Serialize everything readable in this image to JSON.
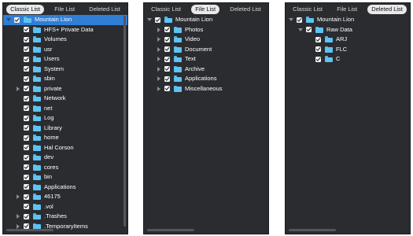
{
  "panels": [
    {
      "tabs": [
        {
          "label": "Classic List",
          "active": true
        },
        {
          "label": "File List",
          "active": false
        },
        {
          "label": "Deleted List",
          "active": false
        }
      ],
      "rows": [
        {
          "label": "Mountain Lion",
          "level": 0,
          "expander": "down",
          "selected": true
        },
        {
          "label": "HFS+ Private Data",
          "level": 1,
          "expander": "none",
          "selected": false
        },
        {
          "label": "Volumes",
          "level": 1,
          "expander": "none",
          "selected": false
        },
        {
          "label": "usr",
          "level": 1,
          "expander": "none",
          "selected": false
        },
        {
          "label": "Users",
          "level": 1,
          "expander": "none",
          "selected": false
        },
        {
          "label": "System",
          "level": 1,
          "expander": "none",
          "selected": false
        },
        {
          "label": "sbin",
          "level": 1,
          "expander": "none",
          "selected": false
        },
        {
          "label": "private",
          "level": 1,
          "expander": "right",
          "selected": false
        },
        {
          "label": "Network",
          "level": 1,
          "expander": "none",
          "selected": false
        },
        {
          "label": "net",
          "level": 1,
          "expander": "none",
          "selected": false
        },
        {
          "label": "Log",
          "level": 1,
          "expander": "none",
          "selected": false
        },
        {
          "label": "Library",
          "level": 1,
          "expander": "none",
          "selected": false
        },
        {
          "label": "home",
          "level": 1,
          "expander": "none",
          "selected": false
        },
        {
          "label": "Hal Corson",
          "level": 1,
          "expander": "none",
          "selected": false
        },
        {
          "label": "dev",
          "level": 1,
          "expander": "none",
          "selected": false
        },
        {
          "label": "cores",
          "level": 1,
          "expander": "none",
          "selected": false
        },
        {
          "label": "bin",
          "level": 1,
          "expander": "none",
          "selected": false
        },
        {
          "label": "Applications",
          "level": 1,
          "expander": "none",
          "selected": false
        },
        {
          "label": "46175",
          "level": 1,
          "expander": "right",
          "selected": false
        },
        {
          "label": ".vol",
          "level": 1,
          "expander": "none",
          "selected": false
        },
        {
          "label": ".Trashes",
          "level": 1,
          "expander": "right",
          "selected": false
        },
        {
          "label": ".TemporaryItems",
          "level": 1,
          "expander": "right",
          "selected": false
        }
      ]
    },
    {
      "tabs": [
        {
          "label": "Classic List",
          "active": false
        },
        {
          "label": "File List",
          "active": true
        },
        {
          "label": "Deleted List",
          "active": false
        }
      ],
      "rows": [
        {
          "label": "Mountain Lion",
          "level": 0,
          "expander": "down",
          "selected": false
        },
        {
          "label": "Photos",
          "level": 1,
          "expander": "right",
          "selected": false
        },
        {
          "label": "Video",
          "level": 1,
          "expander": "right",
          "selected": false
        },
        {
          "label": "Document",
          "level": 1,
          "expander": "right",
          "selected": false
        },
        {
          "label": "Text",
          "level": 1,
          "expander": "right",
          "selected": false
        },
        {
          "label": "Archive",
          "level": 1,
          "expander": "right",
          "selected": false
        },
        {
          "label": "Applications",
          "level": 1,
          "expander": "right",
          "selected": false
        },
        {
          "label": "Miscellaneous",
          "level": 1,
          "expander": "right",
          "selected": false
        }
      ]
    },
    {
      "tabs": [
        {
          "label": "Classic List",
          "active": false
        },
        {
          "label": "File List",
          "active": false
        },
        {
          "label": "Deleted List",
          "active": true
        }
      ],
      "rows": [
        {
          "label": "Mountain Lion",
          "level": 0,
          "expander": "down",
          "selected": false
        },
        {
          "label": "Raw Data",
          "level": 1,
          "expander": "down",
          "selected": false
        },
        {
          "label": "ARJ",
          "level": 2,
          "expander": "none",
          "selected": false
        },
        {
          "label": "FLC",
          "level": 2,
          "expander": "none",
          "selected": false
        },
        {
          "label": "C",
          "level": 2,
          "expander": "none",
          "selected": false
        }
      ]
    }
  ],
  "icons": {
    "folder": "folder-icon",
    "checkbox": "checkbox-checked-icon",
    "expand": "disclosure-triangle-icon"
  },
  "colors": {
    "panel_bg": "#2b2c30",
    "selection": "#2f7fd6",
    "folder": "#5ec3f2",
    "active_tab_bg": "#e9e9eb"
  }
}
